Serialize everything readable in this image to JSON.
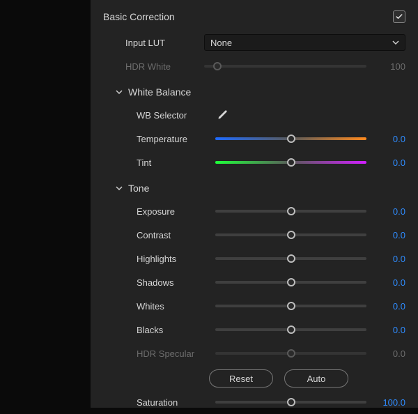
{
  "panel": {
    "title": "Basic Correction",
    "enabled": true
  },
  "input_lut": {
    "label": "Input LUT",
    "selected": "None"
  },
  "hdr_white": {
    "label": "HDR White",
    "value": "100",
    "pos": 0.08,
    "enabled": false
  },
  "white_balance": {
    "title": "White Balance",
    "wb_selector_label": "WB Selector",
    "temperature": {
      "label": "Temperature",
      "value": "0.0",
      "pos": 0.5
    },
    "tint": {
      "label": "Tint",
      "value": "0.0",
      "pos": 0.5
    }
  },
  "tone": {
    "title": "Tone",
    "exposure": {
      "label": "Exposure",
      "value": "0.0",
      "pos": 0.5
    },
    "contrast": {
      "label": "Contrast",
      "value": "0.0",
      "pos": 0.5
    },
    "highlights": {
      "label": "Highlights",
      "value": "0.0",
      "pos": 0.5
    },
    "shadows": {
      "label": "Shadows",
      "value": "0.0",
      "pos": 0.5
    },
    "whites": {
      "label": "Whites",
      "value": "0.0",
      "pos": 0.5
    },
    "blacks": {
      "label": "Blacks",
      "value": "0.0",
      "pos": 0.5
    },
    "hdr_specular": {
      "label": "HDR Specular",
      "value": "0.0",
      "pos": 0.5,
      "enabled": false
    }
  },
  "buttons": {
    "reset": "Reset",
    "auto": "Auto"
  },
  "saturation": {
    "label": "Saturation",
    "value": "100.0",
    "pos": 0.5
  }
}
